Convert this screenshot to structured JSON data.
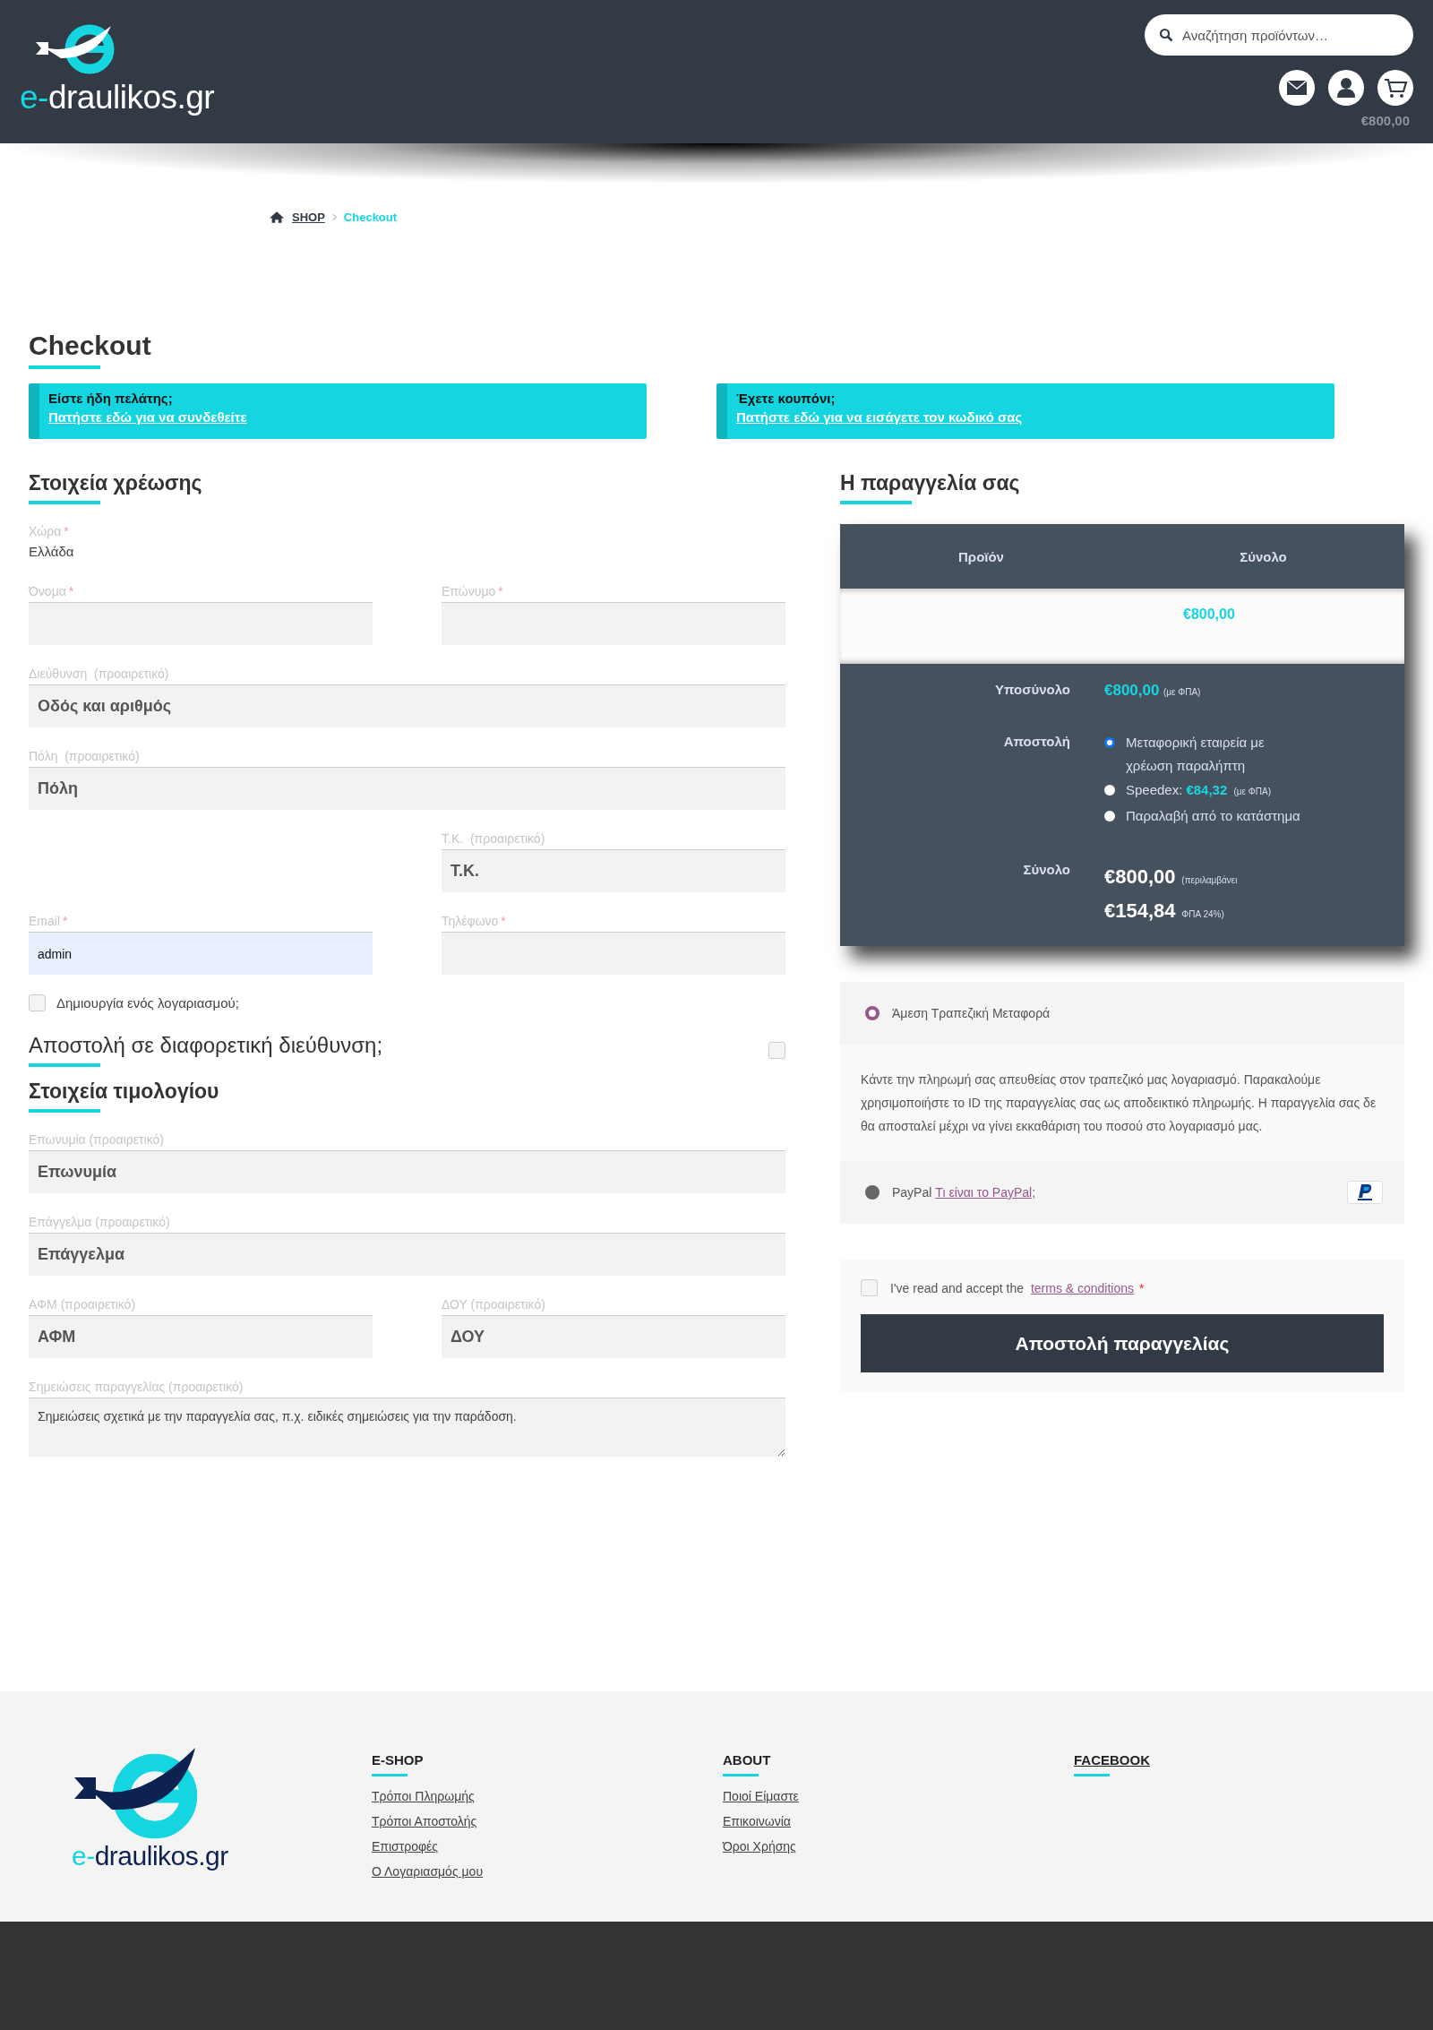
{
  "header": {
    "logo": {
      "prefix": "e-",
      "name": "draulikos.gr"
    },
    "search": {
      "placeholder": "Αναζήτηση προϊόντων…"
    },
    "cart_total": "€800,00"
  },
  "breadcrumb": {
    "link": "SHOP",
    "current": "Checkout"
  },
  "page_title": "Checkout",
  "notices": [
    {
      "title": "Είστε ήδη πελάτης;",
      "link": "Πατήστε εδώ για να συνδεθείτε"
    },
    {
      "title": "Έχετε κουπόνι;",
      "link": "Πατήστε εδώ για να εισάγετε τον κωδικό σας"
    }
  ],
  "billing": {
    "heading": "Στοιχεία χρέωσης",
    "rows": [
      [
        {
          "kind": "static",
          "label": "Χώρα",
          "required_mark": "*",
          "value": "Ελλάδα"
        }
      ],
      [
        {
          "kind": "input",
          "label": "Όνομα",
          "required_mark": "*"
        },
        {
          "kind": "input",
          "label": "Επώνυμο",
          "required_mark": "*"
        }
      ],
      [
        {
          "kind": "input",
          "label": "Διεύθυνση  (προαιρετικό)",
          "placeholder": "Οδός και αριθμός"
        }
      ],
      [
        {
          "kind": "input",
          "label": "Πόλη  (προαιρετικό)",
          "placeholder": "Πόλη"
        }
      ],
      [
        "",
        {
          "kind": "input",
          "label": "Τ.Κ.  (προαιρετικό)",
          "placeholder": "Τ.Κ."
        }
      ],
      [
        {
          "kind": "input",
          "label": "Email",
          "required_mark": "*",
          "value": "admin",
          "autofilled": true
        },
        {
          "kind": "input",
          "label": "Τηλέφωνο",
          "required_mark": "*"
        }
      ]
    ],
    "create_account": {
      "label": "Δημιουργία ενός λογαριασμού;",
      "checked": false
    }
  },
  "ship_different": {
    "label": "Αποστολή σε διαφορετική διεύθυνση;",
    "checked": false
  },
  "invoice": {
    "heading": "Στοιχεία τιμολογίου",
    "rows": [
      [
        {
          "kind": "input",
          "label": "Επωνυμία (προαιρετικό)",
          "placeholder": "Επωνυμία"
        }
      ],
      [
        {
          "kind": "input",
          "label": "Επάγγελμα (προαιρετικό)",
          "placeholder": "Επάγγελμα"
        }
      ],
      [
        {
          "kind": "input",
          "label": "ΑΦΜ (προαιρετικό)",
          "placeholder": "ΑΦΜ"
        },
        {
          "kind": "input",
          "label": "ΔΟΥ (προαιρετικό)",
          "placeholder": "ΔΟΥ"
        }
      ],
      [
        {
          "kind": "textarea",
          "label": "Σημειώσεις παραγγελίας (προαιρετικό)",
          "placeholder": "Σημειώσεις σχετικά με την παραγγελία σας, π.χ. ειδικές σημειώσεις για την παράδοση."
        }
      ]
    ]
  },
  "order": {
    "heading": "Η παραγγελία σας",
    "columns": [
      "Προϊόν",
      "Σύνολο"
    ],
    "item_total": "€800,00",
    "subtotal": {
      "label": "Υποσύνολο",
      "amount": "€800,00",
      "note": "(με ΦΠΑ)"
    },
    "shipping": {
      "label": "Αποστολή",
      "options": [
        {
          "label": "Μεταφορική εταιρεία με χρέωση παραλήπτη",
          "selected": true
        },
        {
          "label": "Speedex:",
          "price": "€84,32",
          "note": "(με ΦΠΑ)",
          "selected": false
        },
        {
          "label": "Παραλαβή από το κατάστημα",
          "selected": false
        }
      ]
    },
    "total": {
      "label": "Σύνολο",
      "text": "**€800,00** (περιλαμβάνει **€154,84** ΦΠΑ 24%)"
    }
  },
  "payment": {
    "methods": [
      {
        "label": "Άμεση Τραπεζική Μεταφορά",
        "selected": true,
        "description": "Κάντε την πληρωμή σας απευθείας στον τραπεζικό μας λογαριασμό. Παρακαλούμε χρησιμοποιήστε το ID της παραγγελίας σας ως αποδεικτικό πληρωμής. Η παραγγελία σας δε θα αποσταλεί μέχρι να γίνει εκκαθάριση του ποσού στο λογαριασμό μας."
      },
      {
        "label": "PayPal",
        "link": "Τι είναι το PayPal;",
        "selected": false,
        "kind": "paypal"
      }
    ]
  },
  "terms": {
    "text": "I've read and accept the",
    "link": "terms & conditions",
    "required_mark": "*",
    "checked": false
  },
  "place_order": "Αποστολή παραγγελίας",
  "footer": {
    "logo": {
      "prefix": "e-",
      "name": "draulikos.gr"
    },
    "columns": [
      {
        "heading": "E-SHOP",
        "links": [
          "Τρόποι Πληρωμής",
          "Τρόποι Αποστολής",
          "Επιστροφές",
          "Ο Λογαριασμός μου"
        ]
      },
      {
        "heading": "ABOUT",
        "links": [
          "Ποιοί Είμαστε",
          "Επικοινωνία",
          "Όροι Χρήσης"
        ]
      },
      {
        "heading": "FACEBOOK",
        "heading_link": true
      }
    ]
  }
}
